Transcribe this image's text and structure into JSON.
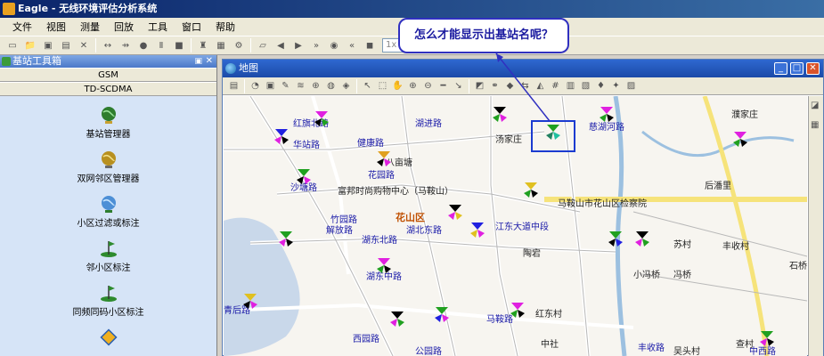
{
  "app": {
    "title": "Eagle - 无线环境评估分析系统"
  },
  "menu": [
    "文件",
    "视图",
    "测量",
    "回放",
    "工具",
    "窗口",
    "帮助"
  ],
  "toolbar": {
    "zoom_value": "1x"
  },
  "left_panel": {
    "title": "基站工具箱",
    "pin_icon": "pin-icon",
    "close_icon": "close-icon",
    "tabs": [
      "GSM",
      "TD-SCDMA"
    ],
    "tools": [
      {
        "label": "基站管理器",
        "icon": "globe-icon"
      },
      {
        "label": "双网邻区管理器",
        "icon": "globe-stand-icon"
      },
      {
        "label": "小区过滤或标注",
        "icon": "globe-filter-icon"
      },
      {
        "label": "邻小区标注",
        "icon": "flag-icon"
      },
      {
        "label": "同频同码小区标注",
        "icon": "flag-icon"
      },
      {
        "label": "",
        "icon": "diamond-icon"
      }
    ]
  },
  "map_window": {
    "title": "地图",
    "labels_blue": [
      "红旗北路",
      "健康路",
      "湖进路",
      "华站路",
      "八亩塘",
      "花园路",
      "沙塘路",
      "竹园路",
      "解放路",
      "湖东北路",
      "湖北东路",
      "江东大道中段",
      "湖东中路",
      "西园路",
      "马鞍路",
      "慈湖河路",
      "青后路",
      "公园路",
      "中西路",
      "丰收路"
    ],
    "labels_dark": [
      "汤家庄",
      "马鞍山市花山区检察院",
      "苏村",
      "丰收村",
      "陶宕",
      "小冯桥",
      "冯桥",
      "红东村",
      "中社",
      "吴头村",
      "查村",
      "后潘里",
      "濮家庄",
      "富邦时尚购物中心（马鞍山）",
      "石桥"
    ],
    "district_label": "花山区"
  },
  "callout": {
    "text": "怎么才能显示出基站名呢？"
  },
  "colors": {
    "accent": "#1b4aa8",
    "callout_border": "#3030c0",
    "road_yellow": "#f6e37a",
    "water": "#c9d8ea"
  }
}
